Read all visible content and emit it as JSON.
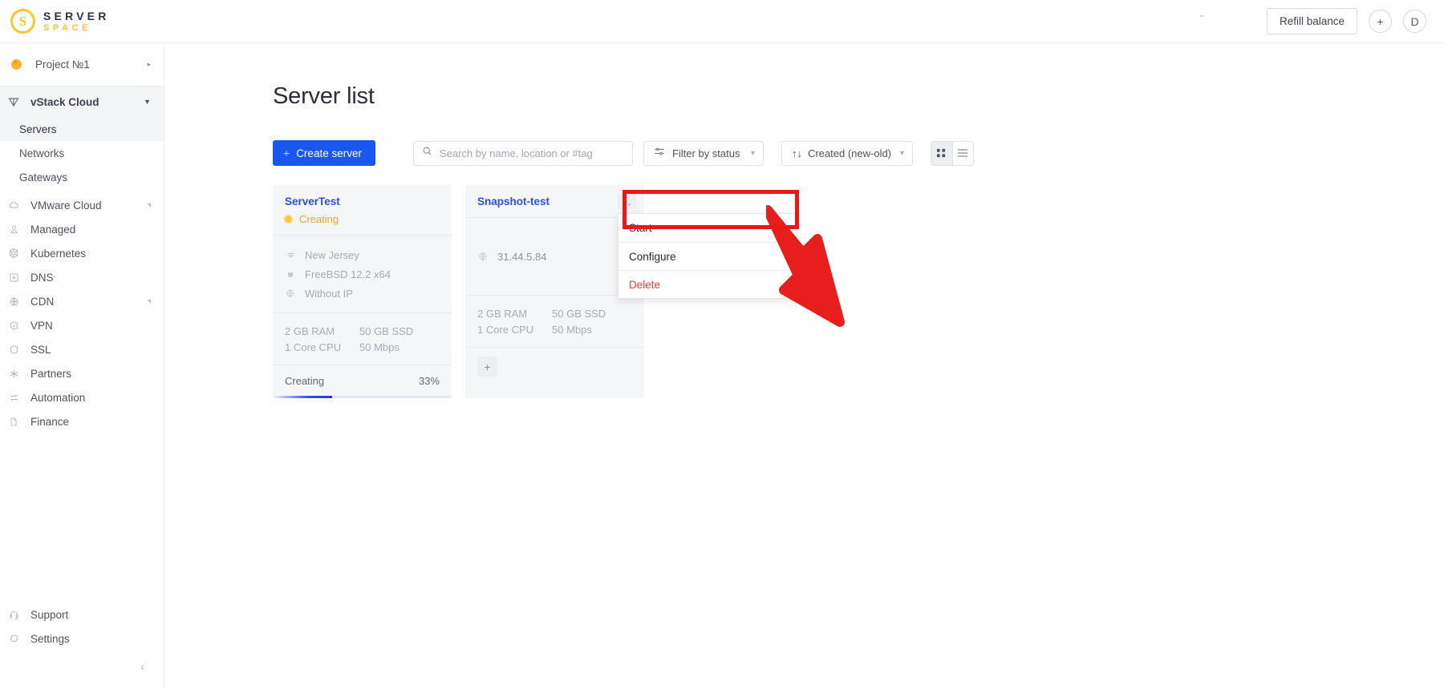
{
  "brand": {
    "name_top": "SERVER",
    "name_bottom": "SPACE",
    "mark": "S",
    "accent": "#ffc529"
  },
  "topbar": {
    "refill_label": "Refill balance",
    "add_label": "+",
    "avatar_label": "D"
  },
  "sidebar": {
    "project": {
      "label": "Project №1",
      "caret": "▸"
    },
    "cloud": {
      "label": "vStack Cloud",
      "icon": "vstack-icon"
    },
    "sub_items": [
      {
        "label": "Servers",
        "active": true
      },
      {
        "label": "Networks",
        "active": false
      },
      {
        "label": "Gateways",
        "active": false
      }
    ],
    "items": [
      {
        "label": "VMware Cloud",
        "icon": "cloud-icon",
        "expandable": true
      },
      {
        "label": "Managed",
        "icon": "person-icon",
        "expandable": false
      },
      {
        "label": "Kubernetes",
        "icon": "kubernetes-icon",
        "expandable": false
      },
      {
        "label": "DNS",
        "icon": "dns-icon",
        "expandable": false
      },
      {
        "label": "CDN",
        "icon": "globe-icon",
        "expandable": true
      },
      {
        "label": "VPN",
        "icon": "vpn-icon",
        "expandable": false
      },
      {
        "label": "SSL",
        "icon": "shield-icon",
        "expandable": false
      },
      {
        "label": "Partners",
        "icon": "partners-icon",
        "expandable": false
      },
      {
        "label": "Automation",
        "icon": "automation-icon",
        "expandable": false
      },
      {
        "label": "Finance",
        "icon": "document-icon",
        "expandable": false
      }
    ],
    "bottom_items": [
      {
        "label": "Support",
        "icon": "headset-icon"
      },
      {
        "label": "Settings",
        "icon": "gear-icon"
      }
    ],
    "collapse": "‹"
  },
  "page": {
    "title": "Server list"
  },
  "toolbar": {
    "create_label": "Create server",
    "create_plus": "+",
    "search_placeholder": "Search by name, location or #tag",
    "search_value": "",
    "filter_label": "Filter by status",
    "sort_label": "Created (new-old)",
    "sort_icon": "↑↓",
    "view_grid": "grid-view",
    "view_list": "list-view",
    "accent": "#1a56f0"
  },
  "cards": [
    {
      "name": "ServerTest",
      "status": "Creating",
      "status_color": "#f5a623",
      "details": [
        {
          "icon": "location-icon",
          "text": "New Jersey"
        },
        {
          "icon": "os-icon",
          "text": "FreeBSD 12.2 x64"
        },
        {
          "icon": "globe-icon",
          "text": "Without IP"
        }
      ],
      "specs": [
        {
          "left": "2 GB RAM",
          "right": "50 GB SSD"
        },
        {
          "left": "1 Core CPU",
          "right": "50 Mbps"
        }
      ],
      "footer": {
        "label": "Creating",
        "percent": "33%",
        "progress": 33
      }
    },
    {
      "name": "Snapshot-test",
      "details": [
        {
          "icon": "globe-icon",
          "text": "31.44.5.84"
        }
      ],
      "specs": [
        {
          "left": "2 GB RAM",
          "right": "50 GB SSD"
        },
        {
          "left": "1 Core CPU",
          "right": "50 Mbps"
        }
      ],
      "add_tag": "+"
    }
  ],
  "dropdown": {
    "items": [
      {
        "label": "Start",
        "danger": false,
        "highlighted": true
      },
      {
        "label": "Configure",
        "danger": false,
        "highlighted": false
      },
      {
        "label": "Delete",
        "danger": true,
        "highlighted": false
      }
    ]
  },
  "annotation": {
    "highlight_color": "#e81818",
    "arrow_color": "#e81e1e"
  }
}
